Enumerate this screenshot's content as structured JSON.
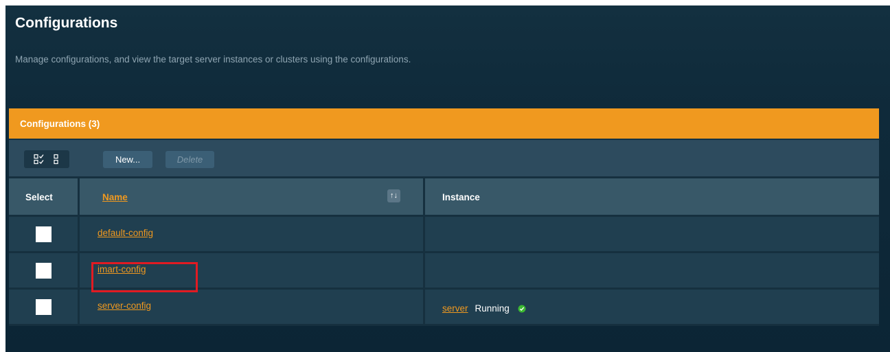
{
  "page": {
    "title": "Configurations",
    "description": "Manage configurations, and view the target server instances or clusters using the configurations."
  },
  "table": {
    "caption": "Configurations (3)",
    "toolbar": {
      "select_all_icon": "select-all-icon",
      "deselect_all_icon": "deselect-all-icon",
      "new_label": "New...",
      "delete_label": "Delete"
    },
    "columns": {
      "select": "Select",
      "name": "Name",
      "instance": "Instance",
      "sort_icon": "sort-icon"
    },
    "rows": [
      {
        "name": "default-config",
        "instance": "",
        "status": ""
      },
      {
        "name": "imart-config",
        "instance": "",
        "status": ""
      },
      {
        "name": "server-config",
        "instance": "server",
        "status": "Running"
      }
    ]
  },
  "colors": {
    "accent": "#f0991f",
    "highlight": "#e11b22",
    "status_ok": "#3cb832"
  }
}
